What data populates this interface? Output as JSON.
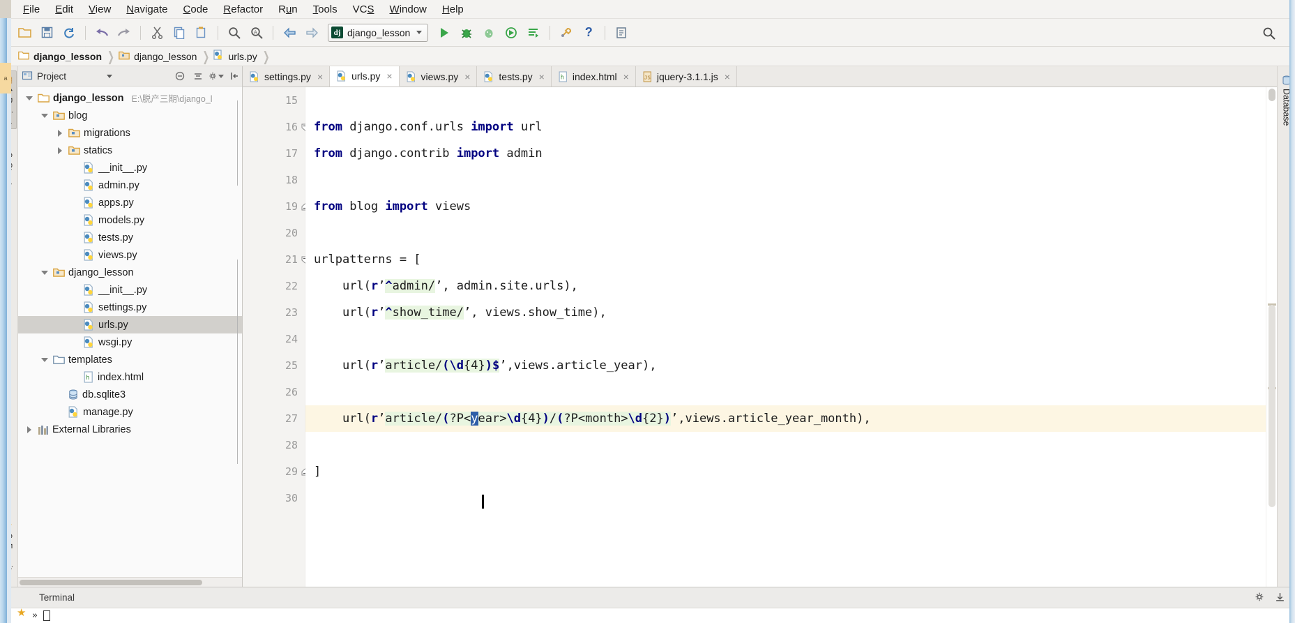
{
  "menubar": {
    "items": [
      {
        "label": "File",
        "mnemonic": "F"
      },
      {
        "label": "Edit",
        "mnemonic": "E"
      },
      {
        "label": "View",
        "mnemonic": "V"
      },
      {
        "label": "Navigate",
        "mnemonic": "N"
      },
      {
        "label": "Code",
        "mnemonic": "C"
      },
      {
        "label": "Refactor",
        "mnemonic": "R"
      },
      {
        "label": "Run",
        "mnemonic": "u"
      },
      {
        "label": "Tools",
        "mnemonic": "T"
      },
      {
        "label": "VCS",
        "mnemonic": "S"
      },
      {
        "label": "Window",
        "mnemonic": "W"
      },
      {
        "label": "Help",
        "mnemonic": "H"
      }
    ]
  },
  "toolbar": {
    "icons": [
      "open-folder-icon",
      "save-all-icon",
      "sync-refresh-icon",
      "undo-icon",
      "redo-icon",
      "cut-icon",
      "copy-icon",
      "paste-icon",
      "find-icon",
      "replace-icon",
      "back-icon",
      "forward-icon"
    ],
    "run_config": {
      "badge": "dj",
      "label": "django_lesson"
    },
    "run_icons": [
      "run-icon",
      "debug-icon",
      "run-coverage-icon",
      "run-with-profiler-icon",
      "attach-console-icon",
      "settings-wrench-icon",
      "help-icon",
      "update-project-icon"
    ],
    "search_icon": "search-everywhere-icon"
  },
  "breadcrumb": {
    "items": [
      {
        "label": "django_lesson",
        "icon": "folder-icon",
        "bold": true
      },
      {
        "label": "django_lesson",
        "icon": "module-folder-icon",
        "bold": false
      },
      {
        "label": "urls.py",
        "icon": "python-file-icon",
        "bold": false
      }
    ]
  },
  "left_tool_strip": {
    "top": [
      {
        "label": "1: Project",
        "icon": "project-icon",
        "active": true
      },
      {
        "label": "2: Structure",
        "icon": "structure-icon",
        "active": false
      }
    ],
    "bottom": [
      {
        "label": "2: Favorites",
        "icon": "favorites-star-icon",
        "active": false
      }
    ]
  },
  "right_tool_strip": {
    "items": [
      {
        "label": "Database",
        "icon": "database-icon"
      }
    ]
  },
  "project_panel": {
    "title": "Project",
    "title_icon": "project-view-icon",
    "dropdown_icon": "chevron-down-icon",
    "header_buttons": [
      "collapse-all-icon",
      "scroll-from-source-icon",
      "settings-gear-icon",
      "hide-panel-icon"
    ],
    "tree": [
      {
        "depth": 0,
        "label": "django_lesson",
        "icon": "folder-root-icon",
        "toggle": "expanded",
        "bold": true,
        "path": "E:\\脱产三期\\django_l",
        "selected": false
      },
      {
        "depth": 1,
        "label": "blog",
        "icon": "module-folder-icon",
        "toggle": "expanded",
        "bold": false,
        "path": "",
        "selected": false
      },
      {
        "depth": 2,
        "label": "migrations",
        "icon": "module-folder-icon",
        "toggle": "collapsed",
        "bold": false,
        "path": "",
        "selected": false
      },
      {
        "depth": 2,
        "label": "statics",
        "icon": "module-folder-icon",
        "toggle": "collapsed",
        "bold": false,
        "path": "",
        "selected": false
      },
      {
        "depth": 3,
        "label": "__init__.py",
        "icon": "python-file-icon",
        "toggle": "none",
        "bold": false,
        "path": "",
        "selected": false
      },
      {
        "depth": 3,
        "label": "admin.py",
        "icon": "python-file-icon",
        "toggle": "none",
        "bold": false,
        "path": "",
        "selected": false
      },
      {
        "depth": 3,
        "label": "apps.py",
        "icon": "python-file-icon",
        "toggle": "none",
        "bold": false,
        "path": "",
        "selected": false
      },
      {
        "depth": 3,
        "label": "models.py",
        "icon": "python-file-icon",
        "toggle": "none",
        "bold": false,
        "path": "",
        "selected": false
      },
      {
        "depth": 3,
        "label": "tests.py",
        "icon": "python-file-icon",
        "toggle": "none",
        "bold": false,
        "path": "",
        "selected": false
      },
      {
        "depth": 3,
        "label": "views.py",
        "icon": "python-file-icon",
        "toggle": "none",
        "bold": false,
        "path": "",
        "selected": false
      },
      {
        "depth": 1,
        "label": "django_lesson",
        "icon": "module-folder-icon",
        "toggle": "expanded",
        "bold": false,
        "path": "",
        "selected": false
      },
      {
        "depth": 3,
        "label": "__init__.py",
        "icon": "python-file-icon",
        "toggle": "none",
        "bold": false,
        "path": "",
        "selected": false
      },
      {
        "depth": 3,
        "label": "settings.py",
        "icon": "python-file-icon",
        "toggle": "none",
        "bold": false,
        "path": "",
        "selected": false
      },
      {
        "depth": 3,
        "label": "urls.py",
        "icon": "python-file-icon",
        "toggle": "none",
        "bold": false,
        "path": "",
        "selected": true
      },
      {
        "depth": 3,
        "label": "wsgi.py",
        "icon": "python-file-icon",
        "toggle": "none",
        "bold": false,
        "path": "",
        "selected": false
      },
      {
        "depth": 1,
        "label": "templates",
        "icon": "folder-icon",
        "toggle": "expanded",
        "bold": false,
        "path": "",
        "selected": false
      },
      {
        "depth": 3,
        "label": "index.html",
        "icon": "html-file-icon",
        "toggle": "none",
        "bold": false,
        "path": "",
        "selected": false
      },
      {
        "depth": 2,
        "label": "db.sqlite3",
        "icon": "database-file-icon",
        "toggle": "none",
        "bold": false,
        "path": "",
        "selected": false
      },
      {
        "depth": 2,
        "label": "manage.py",
        "icon": "python-file-icon",
        "toggle": "none",
        "bold": false,
        "path": "",
        "selected": false
      },
      {
        "depth": 0,
        "label": "External Libraries",
        "icon": "libraries-icon",
        "toggle": "collapsed",
        "bold": false,
        "path": "",
        "selected": false
      }
    ]
  },
  "editor": {
    "tabs": [
      {
        "label": "settings.py",
        "icon": "python-file-icon",
        "active": false,
        "close": "×"
      },
      {
        "label": "urls.py",
        "icon": "python-file-icon",
        "active": true,
        "close": "×"
      },
      {
        "label": "views.py",
        "icon": "python-file-icon",
        "active": false,
        "close": "×"
      },
      {
        "label": "tests.py",
        "icon": "python-file-icon",
        "active": false,
        "close": "×"
      },
      {
        "label": "index.html",
        "icon": "html-file-icon",
        "active": false,
        "close": "×"
      },
      {
        "label": "jquery-3.1.1.js",
        "icon": "js-file-icon",
        "active": false,
        "close": "×"
      }
    ],
    "first_visible_line": 15,
    "lines": [
      {
        "no": "15",
        "fold": "none",
        "highlight": false,
        "text": ""
      },
      {
        "no": "16",
        "fold": "expanded",
        "highlight": false,
        "text": "from django.conf.urls import url"
      },
      {
        "no": "17",
        "fold": "none",
        "highlight": false,
        "text": "from django.contrib import admin"
      },
      {
        "no": "18",
        "fold": "none",
        "highlight": false,
        "text": ""
      },
      {
        "no": "19",
        "fold": "end",
        "highlight": false,
        "text": "from blog import views"
      },
      {
        "no": "20",
        "fold": "none",
        "highlight": false,
        "text": ""
      },
      {
        "no": "21",
        "fold": "expanded",
        "highlight": false,
        "text": "urlpatterns = ["
      },
      {
        "no": "22",
        "fold": "none",
        "highlight": false,
        "text": "    url(r'^admin/', admin.site.urls),"
      },
      {
        "no": "23",
        "fold": "none",
        "highlight": false,
        "text": "    url(r'^show_time/', views.show_time),"
      },
      {
        "no": "24",
        "fold": "none",
        "highlight": false,
        "text": ""
      },
      {
        "no": "25",
        "fold": "none",
        "highlight": false,
        "text": "    url(r'article/(\\d{4})$',views.article_year),"
      },
      {
        "no": "26",
        "fold": "none",
        "highlight": false,
        "text": ""
      },
      {
        "no": "27",
        "fold": "none",
        "highlight": true,
        "text": "    url(r'article/(?P<year>\\d{4})/(?P<month>\\d{2})',views.article_year_month),"
      },
      {
        "no": "28",
        "fold": "none",
        "highlight": false,
        "text": ""
      },
      {
        "no": "29",
        "fold": "end",
        "highlight": false,
        "text": "]"
      },
      {
        "no": "30",
        "fold": "none",
        "highlight": false,
        "text": ""
      }
    ],
    "selection": {
      "line": "27",
      "text": "y"
    },
    "scrollbar_markers": [
      "#c9c2b0",
      "#c9c2b0"
    ]
  },
  "bottom": {
    "tabs": [
      {
        "label": "Terminal",
        "icon": "terminal-icon"
      }
    ],
    "right_icons": [
      "settings-gear-icon",
      "hide-icon"
    ],
    "terminal_prompt": "»",
    "terminal_cursor": ""
  },
  "colors": {
    "accent_blue": "#2f5ea8",
    "highlight_line": "#fdf6e3",
    "regex_bg": "#e8f5e0",
    "keyword": "#000080",
    "selected_row": "#d2d0cc",
    "panel_bg": "#fafafa",
    "chrome_bg": "#f4f3f1"
  }
}
